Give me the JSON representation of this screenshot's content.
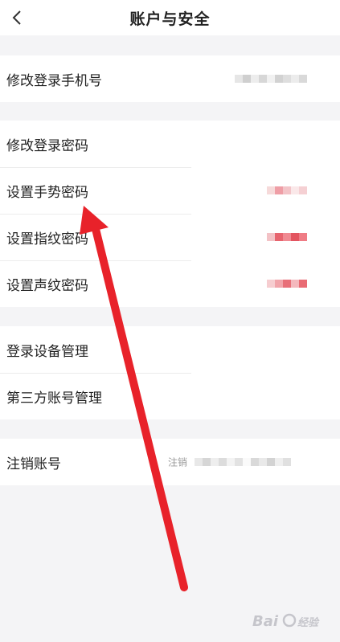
{
  "header": {
    "title": "账户与安全",
    "back_icon": "chevron-left-icon"
  },
  "groups": [
    {
      "rows": [
        {
          "label": "修改登录手机号"
        }
      ]
    },
    {
      "rows": [
        {
          "label": "修改登录密码"
        },
        {
          "label": "设置手势密码"
        },
        {
          "label": "设置指纹密码"
        },
        {
          "label": "设置声纹密码"
        }
      ]
    },
    {
      "rows": [
        {
          "label": "登录设备管理"
        },
        {
          "label": "第三方账号管理"
        }
      ]
    },
    {
      "rows": [
        {
          "label": "注销账号",
          "hint": "注销"
        }
      ]
    }
  ],
  "colors": {
    "background": "#f4f4f6",
    "card": "#ffffff",
    "text": "#222222",
    "hint": "#999999",
    "annotation_arrow": "#e8222a"
  }
}
